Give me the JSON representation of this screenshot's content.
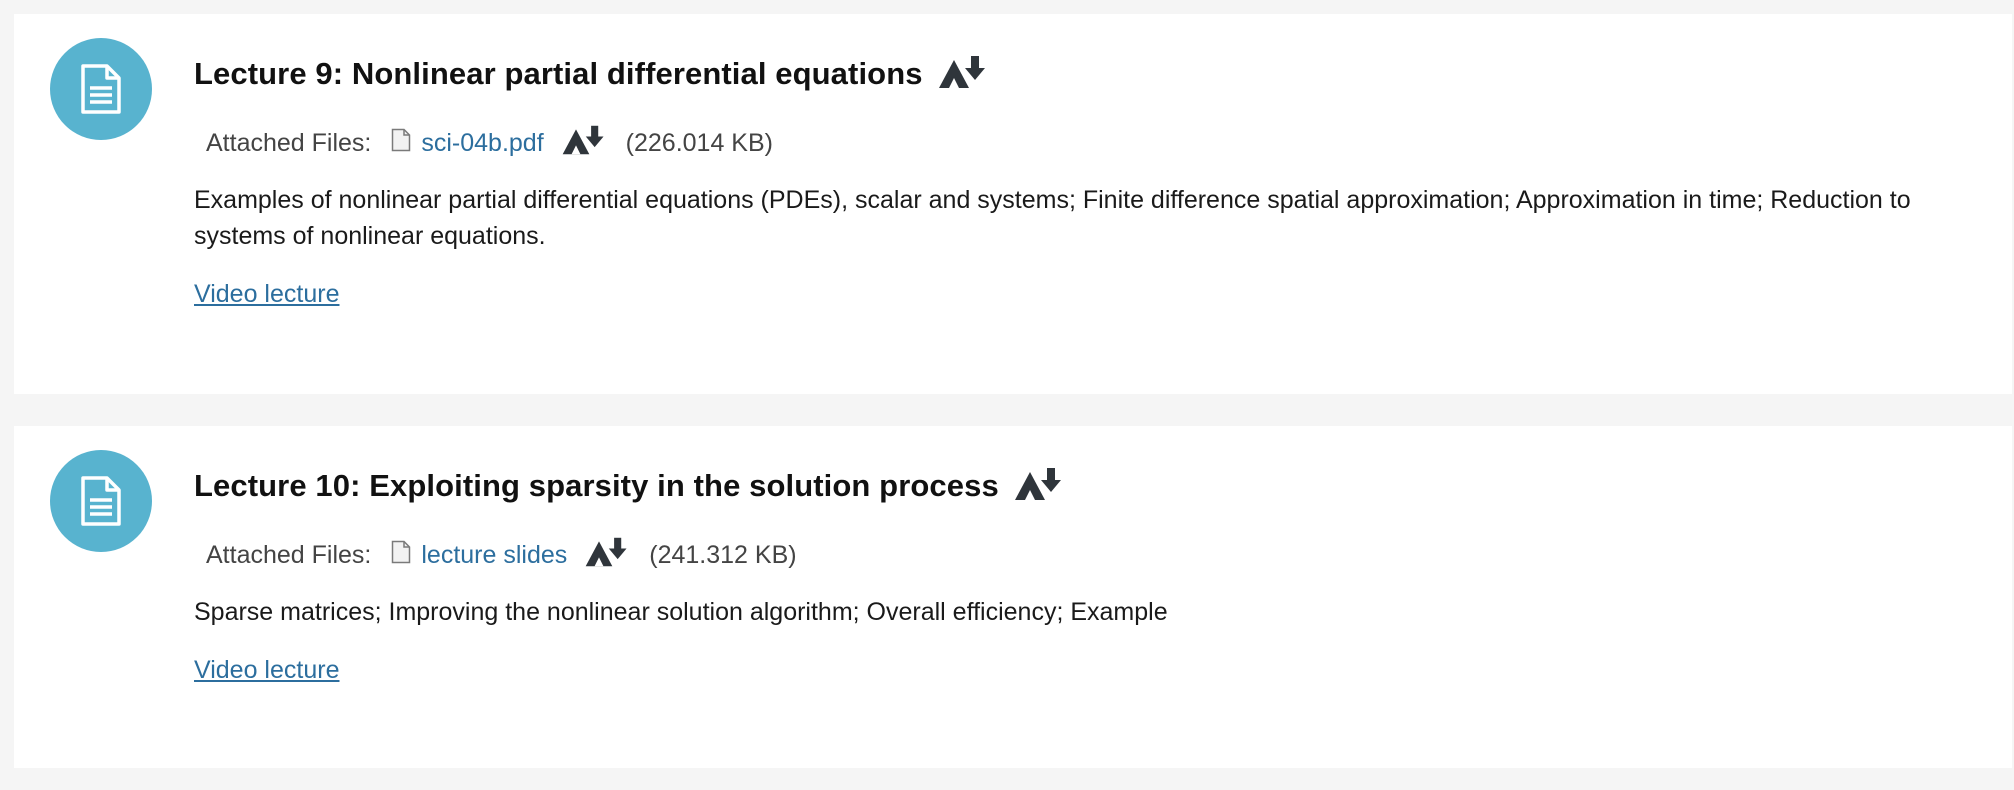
{
  "lectures": [
    {
      "title": "Lecture 9: Nonlinear partial differential equations",
      "attached_label": "Attached Files:",
      "file_name": "sci-04b.pdf",
      "file_size": "(226.014 KB)",
      "description": "Examples of nonlinear partial differential equations (PDEs), scalar and systems; Finite difference spatial approximation; Approximation in time; Reduction to systems of nonlinear equations.",
      "video_label": "Video lecture"
    },
    {
      "title": "Lecture 10: Exploiting sparsity in the solution process",
      "attached_label": "Attached Files:",
      "file_name": "lecture slides",
      "file_size": "(241.312 KB)",
      "description": "Sparse matrices; Improving the nonlinear solution algorithm; Overall efficiency; Example",
      "video_label": "Video lecture"
    }
  ],
  "icons": {
    "item_type": "document-icon",
    "alternative_formats": "alternative-formats-icon",
    "file": "file-icon"
  },
  "colors": {
    "accent_circle": "#58b3cf",
    "link": "#2c6e9e",
    "page_background": "#f5f5f5"
  }
}
